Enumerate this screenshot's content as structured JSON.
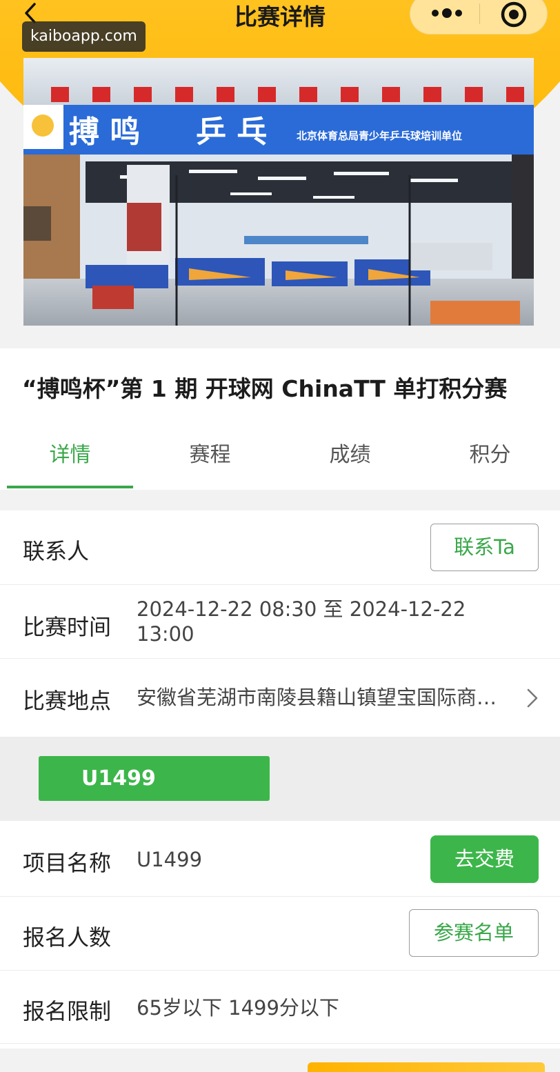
{
  "header": {
    "title": "比赛详情",
    "watermark": "kaiboapp.com"
  },
  "photo": {
    "sign_text": "搏 鸣",
    "sign_text2": "乒 乓",
    "sign_small": "北京体育总局青少年乒乓球培训单位"
  },
  "event": {
    "title": "“搏鸣杯”第 1 期 开球网 ChinaTT 单打积分赛"
  },
  "tabs": [
    {
      "label": "详情",
      "active": true
    },
    {
      "label": "赛程",
      "active": false
    },
    {
      "label": "成绩",
      "active": false
    },
    {
      "label": "积分",
      "active": false
    }
  ],
  "info": {
    "contact_label": "联系人",
    "contact_button": "联系Ta",
    "time_label": "比赛时间",
    "time_value_line1": "2024-12-22 08:30 至 2024-12-22",
    "time_value_line2": "13:00",
    "place_label": "比赛地点",
    "place_value": "安徽省芜湖市南陵县籍山镇望宝国际商…"
  },
  "group": {
    "tag": "U1499"
  },
  "item": {
    "name_label": "项目名称",
    "name_value": "U1499",
    "pay_button": "去交费",
    "count_label": "报名人数",
    "roster_button": "参赛名单",
    "limit_label": "报名限制",
    "limit_value": "65岁以下 1499分以下"
  },
  "colors": {
    "accent_green": "#3cb64a",
    "header_yellow": "#ffc21f"
  }
}
